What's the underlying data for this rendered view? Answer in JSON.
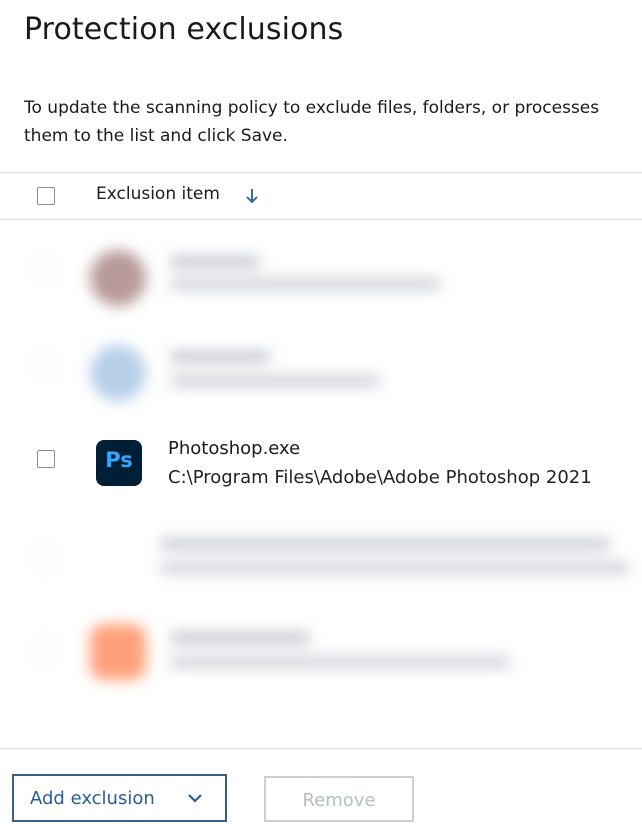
{
  "page": {
    "title": "Protection exclusions",
    "description_line1": "To update the scanning policy to exclude files, folders, or processes",
    "description_line2": "them to the list and click Save."
  },
  "table": {
    "column_header": "Exclusion item",
    "sort_icon": "arrow-down-icon",
    "visible_item": {
      "name": "Photoshop.exe",
      "path": "C:\\Program Files\\Adobe\\Adobe Photoshop 2021",
      "icon": "photoshop-app-icon",
      "icon_text": "Ps"
    }
  },
  "footer": {
    "add_label": "Add exclusion",
    "remove_label": "Remove"
  },
  "colors": {
    "accent": "#2a5d9a",
    "ps_bg": "#001e36",
    "ps_fg": "#31a8ff",
    "divider": "#d7dde3"
  }
}
